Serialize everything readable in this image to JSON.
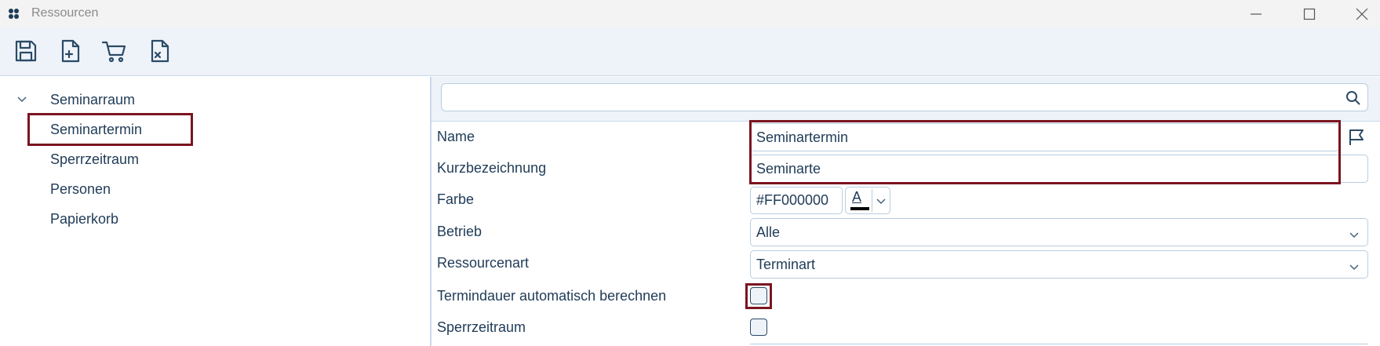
{
  "window": {
    "title": "Ressourcen"
  },
  "toolbar": {
    "buttons": [
      "save-icon",
      "new-document-icon",
      "cart-icon",
      "delete-document-icon"
    ]
  },
  "tree": {
    "root": "Seminarraum",
    "items": [
      "Seminartermin",
      "Sperrzeitraum",
      "Personen",
      "Papierkorb"
    ],
    "selected": "Seminartermin"
  },
  "search": {
    "placeholder": "",
    "value": ""
  },
  "form": {
    "name_label": "Name",
    "name_value": "Seminartermin",
    "kurz_label": "Kurzbezeichnung",
    "kurz_value": "Seminarte",
    "farbe_label": "Farbe",
    "farbe_value": "#FF000000",
    "farbe_button": "A",
    "betrieb_label": "Betrieb",
    "betrieb_value": "Alle",
    "ressourcenart_label": "Ressourcenart",
    "ressourcenart_value": "Terminart",
    "termindauer_label": "Termindauer automatisch berechnen",
    "termindauer_checked": false,
    "sperrzeitraum_label": "Sperrzeitraum",
    "sperrzeitraum_checked": false
  },
  "colors": {
    "highlight": "#7b1420",
    "text": "#1f3b57",
    "panel": "#eef3f9"
  }
}
